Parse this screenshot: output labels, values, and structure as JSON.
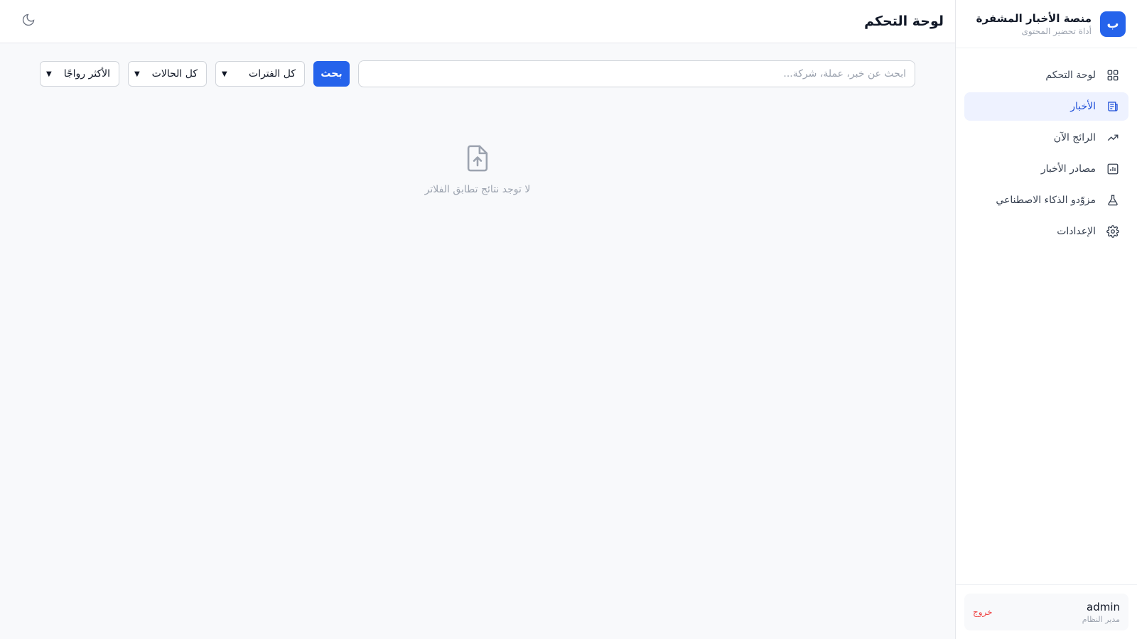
{
  "brand": {
    "logo_letter": "ب",
    "title": "منصة الأخبار المشفرة",
    "subtitle": "أداة تحضير المحتوى",
    "accent": "#2563eb"
  },
  "sidebar": {
    "items": [
      {
        "label": "لوحة التحكم",
        "icon": "dashboard-grid-icon",
        "active": false
      },
      {
        "label": "الأخبار",
        "icon": "newspaper-icon",
        "active": true
      },
      {
        "label": "الرائج الآن",
        "icon": "trending-up-icon",
        "active": false
      },
      {
        "label": "مصادر الأخبار",
        "icon": "bar-chart-icon",
        "active": false
      },
      {
        "label": "مزوّدو الذكاء الاصطناعي",
        "icon": "flask-icon",
        "active": false
      },
      {
        "label": "الإعدادات",
        "icon": "gear-icon",
        "active": false
      }
    ]
  },
  "user": {
    "name": "admin",
    "role": "مدير النظام",
    "logout_label": "خروج",
    "logout_color": "#ef4444"
  },
  "header": {
    "title": "لوحة التحكم",
    "theme_icon": "moon-icon"
  },
  "filters": {
    "search_placeholder": "ابحث عن خبر، عملة، شركة...",
    "search_value": "",
    "search_button": "بحث",
    "period_selected": "كل الفترات",
    "status_selected": "كل الحالات",
    "sort_selected": "الأكثر رواجًا"
  },
  "empty_state": {
    "icon": "file-upload-icon",
    "message": "لا توجد نتائج تطابق الفلاتر"
  }
}
